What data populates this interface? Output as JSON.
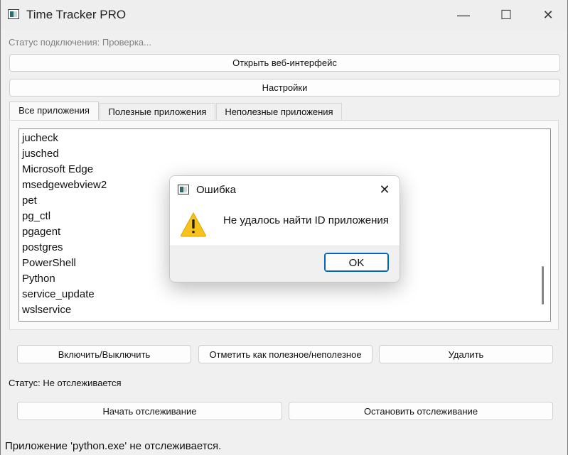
{
  "window": {
    "title": "Time Tracker PRO",
    "controls": {
      "minimize": "—",
      "maximize": "☐",
      "close": "✕"
    }
  },
  "connection_status": "Статус подключения: Проверка...",
  "buttons": {
    "open_web": "Открыть веб-интерфейс",
    "settings": "Настройки",
    "toggle": "Включить/Выключить",
    "mark": "Отметить как полезное/неполезное",
    "delete": "Удалить",
    "start_tracking": "Начать отслеживание",
    "stop_tracking": "Остановить отслеживание"
  },
  "tabs": [
    "Все приложения",
    "Полезные приложения",
    "Неполезные приложения"
  ],
  "apps": [
    "jucheck",
    "jusched",
    "Microsoft Edge",
    "msedgewebview2",
    "pet",
    "pg_ctl",
    "pgagent",
    "postgres",
    "PowerShell",
    "Python",
    "service_update",
    "wslservice"
  ],
  "status": "Статус: Не отслеживается",
  "bottom_message": "Приложение 'python.exe' не отслеживается.",
  "dialog": {
    "title": "Ошибка",
    "close": "✕",
    "message": "Не удалось найти ID приложения",
    "ok": "OK",
    "icon": "warning-icon"
  },
  "colors": {
    "accent": "#0067c0",
    "warning": "#f7c21b"
  }
}
